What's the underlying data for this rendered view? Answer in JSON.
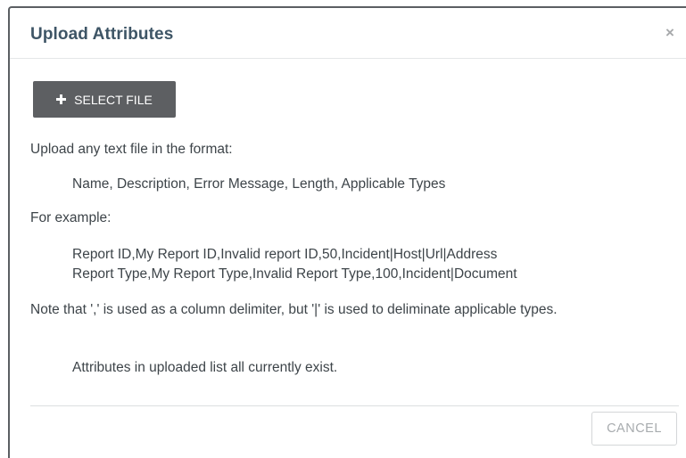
{
  "dialog": {
    "title": "Upload Attributes",
    "close_glyph": "×",
    "select_file_label": "SELECT FILE",
    "format_intro": "Upload any text file in the format:",
    "format_line": "Name, Description, Error Message, Length, Applicable Types",
    "example_intro": "For example:",
    "example_lines": [
      "Report ID,My Report ID,Invalid report ID,50,Incident|Host|Url|Address",
      "Report Type,My Report Type,Invalid Report Type,100,Incident|Document"
    ],
    "note": "Note that ',' is used as a column delimiter, but '|' is used to deliminate applicable types.",
    "status": "Attributes in uploaded list all currently exist.",
    "cancel_label": "CANCEL"
  },
  "icons": {
    "close": "close-icon",
    "select_file": "plus-icon"
  },
  "colors": {
    "title": "#3e5566",
    "primary_button": "#5d5f62",
    "body_text": "#3d4449",
    "cancel_text": "#a7abae"
  }
}
